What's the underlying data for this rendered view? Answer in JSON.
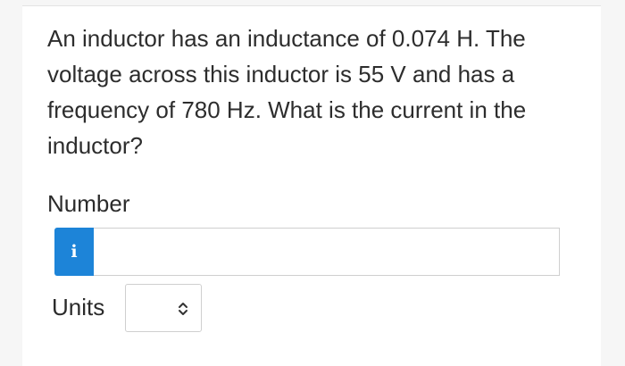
{
  "question": {
    "text": "An inductor has an inductance of 0.074 H. The voltage across this inductor is 55 V and has a frequency of 780 Hz. What is the current in the inductor?"
  },
  "answer": {
    "number_label": "Number",
    "info_icon_glyph": "i",
    "number_value": "",
    "number_placeholder": "",
    "units_label": "Units",
    "units_selected": ""
  },
  "icons": {
    "info": "info-icon",
    "chevron": "chevron-up-down-icon"
  },
  "colors": {
    "info_button_bg": "#1d84d8",
    "input_border": "#cfcfcf"
  }
}
